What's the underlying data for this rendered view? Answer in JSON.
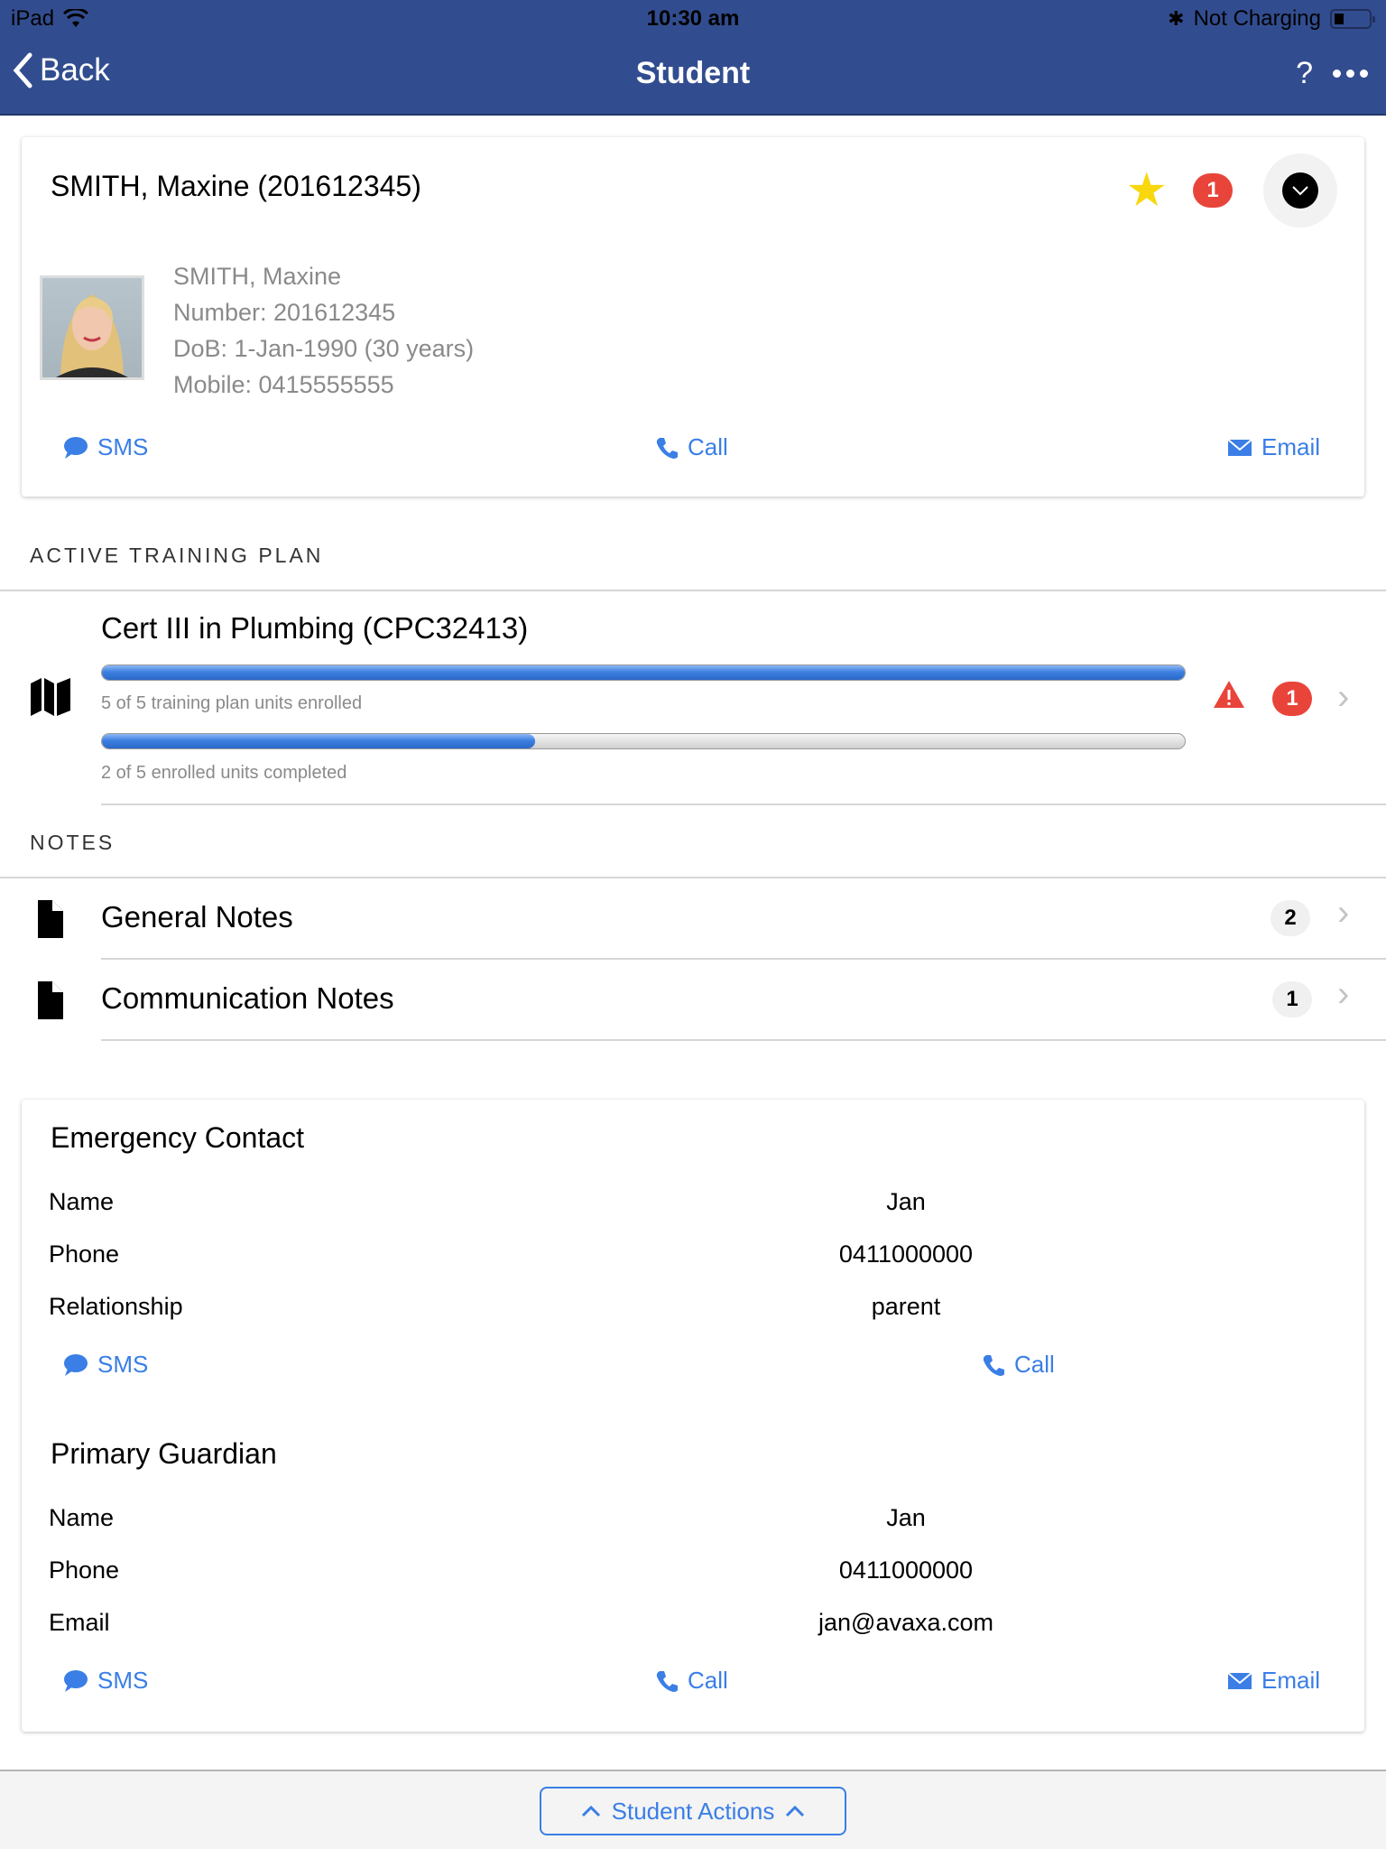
{
  "status_bar": {
    "device": "iPad",
    "time": "10:30 am",
    "charging": "Not Charging"
  },
  "nav": {
    "back_label": "Back",
    "title": "Student",
    "help_label": "?"
  },
  "student": {
    "heading": "SMITH, Maxine (201612345)",
    "alert_count": "1",
    "name": "SMITH, Maxine",
    "number": "Number: 201612345",
    "dob": "DoB: 1-Jan-1990 (30 years)",
    "mobile": "Mobile: 0415555555",
    "actions": {
      "sms": "SMS",
      "call": "Call",
      "email": "Email"
    }
  },
  "training": {
    "section_label": "ACTIVE TRAINING PLAN",
    "title": "Cert III in Plumbing (CPC32413)",
    "enrolled_caption": "5 of 5 training plan units enrolled",
    "enrolled_fraction": 1.0,
    "completed_caption": "2 of 5 enrolled units completed",
    "completed_fraction": 0.4,
    "alert_count": "1"
  },
  "notes": {
    "section_label": "NOTES",
    "items": [
      {
        "label": "General Notes",
        "count": "2"
      },
      {
        "label": "Communication Notes",
        "count": "1"
      }
    ]
  },
  "emergency_contact": {
    "title": "Emergency Contact",
    "rows": [
      {
        "label": "Name",
        "value": "Jan"
      },
      {
        "label": "Phone",
        "value": "0411000000"
      },
      {
        "label": "Relationship",
        "value": "parent"
      }
    ],
    "actions": {
      "sms": "SMS",
      "call": "Call"
    }
  },
  "primary_guardian": {
    "title": "Primary Guardian",
    "rows": [
      {
        "label": "Name",
        "value": "Jan"
      },
      {
        "label": "Phone",
        "value": "0411000000"
      },
      {
        "label": "Email",
        "value": "jan@avaxa.com"
      }
    ],
    "actions": {
      "sms": "SMS",
      "call": "Call",
      "email": "Email"
    }
  },
  "footer": {
    "student_actions_label": "Student Actions"
  },
  "colors": {
    "nav_bg": "#324d8f",
    "accent": "#3a7ee6",
    "alert_red": "#e9443a",
    "star": "#f8d70c"
  }
}
